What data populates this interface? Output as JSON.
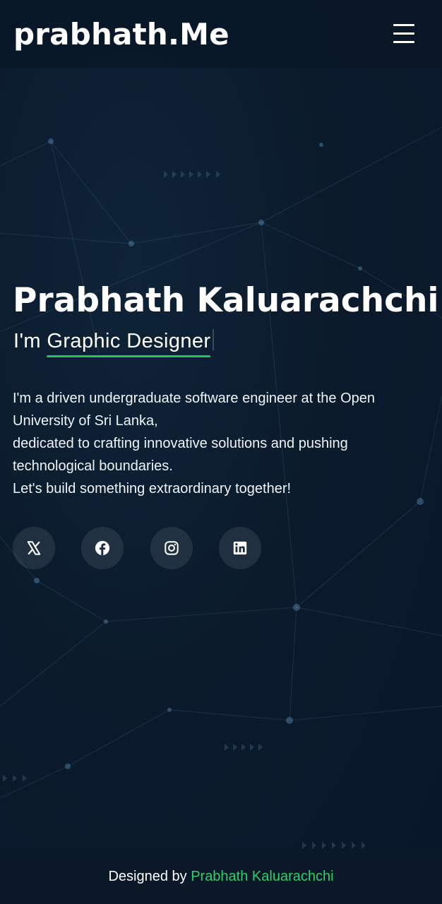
{
  "header": {
    "logo": "prabhath.Me",
    "menu_icon": "hamburger-menu-icon"
  },
  "hero": {
    "name": "Prabhath Kaluarachchi",
    "role_prefix": "I'm",
    "role_typed": "Graphic Designer",
    "about_lines": [
      "I'm a driven undergraduate software engineer at the Open University of Sri Lanka,",
      "dedicated to crafting innovative solutions and pushing technological boundaries.",
      "Let's build something extraordinary together!"
    ]
  },
  "socials": [
    {
      "icon": "x-twitter-icon"
    },
    {
      "icon": "facebook-icon"
    },
    {
      "icon": "instagram-icon"
    },
    {
      "icon": "linkedin-icon"
    }
  ],
  "footer": {
    "prefix": "Designed by",
    "author": "Prabhath Kaluarachchi"
  },
  "colors": {
    "background": "#0b1b2c",
    "accent": "#2ecf6c",
    "text": "#ffffff"
  }
}
